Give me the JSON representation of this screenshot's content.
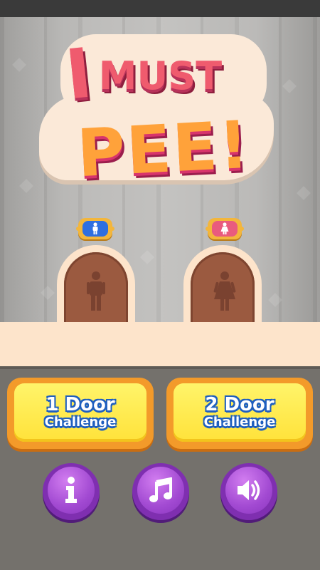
{
  "title": {
    "line1_i": "I",
    "line1_rest": "MUST",
    "line2": "PEE!"
  },
  "restrooms": [
    {
      "sign": "male-sign-icon",
      "door_figure": "man-icon"
    },
    {
      "sign": "female-sign-icon",
      "door_figure": "woman-icon"
    }
  ],
  "challenges": [
    {
      "line1": "1 Door",
      "line2": "Challenge"
    },
    {
      "line1": "2 Door",
      "line2": "Challenge"
    }
  ],
  "bottom_buttons": [
    {
      "icon": "info-icon"
    },
    {
      "icon": "music-note-icon"
    },
    {
      "icon": "speaker-icon"
    }
  ],
  "colors": {
    "title_pink": "#ef5b6e",
    "title_orange": "#ffa23a",
    "button_yellow": "#ffe23a",
    "button_purple": "#a24ad2",
    "male_blue": "#2f6fe0",
    "female_pink": "#e95b7e"
  }
}
